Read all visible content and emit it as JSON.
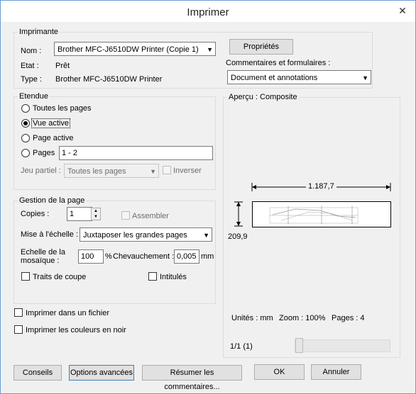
{
  "window": {
    "title": "Imprimer",
    "close_symbol": "✕"
  },
  "printer": {
    "group_label": "Imprimante",
    "name_label": "Nom :",
    "name_value": "Brother MFC-J6510DW Printer (Copie 1)",
    "status_label": "Etat :",
    "status_value": "Prêt",
    "type_label": "Type :",
    "type_value": "Brother MFC-J6510DW Printer",
    "properties_button": "Propriétés",
    "comments_label": "Commentaires et formulaires :",
    "comments_value": "Document et annotations"
  },
  "range": {
    "group_label": "Etendue",
    "options": [
      "Toutes les pages",
      "Vue active",
      "Page active",
      "Pages"
    ],
    "selected": "Vue active",
    "pages_value": "1 - 2",
    "subset_label": "Jeu partiel :",
    "subset_value": "Toutes les pages",
    "reverse_label": "Inverser"
  },
  "page_handling": {
    "group_label": "Gestion de la page",
    "copies_label": "Copies :",
    "copies_value": "1",
    "collate_label": "Assembler",
    "scaling_label": "Mise à l'échelle :",
    "scaling_value": "Juxtaposer les grandes pages",
    "tile_scale_label_1": "Echelle de la",
    "tile_scale_label_2": "mosaïque :",
    "tile_scale_value": "100",
    "percent": "%",
    "overlap_label": "Chevauchement :",
    "overlap_value": "0,005",
    "overlap_unit": "mm",
    "cut_marks_label": "Traits de coupe",
    "labels_label": "Intitulés"
  },
  "output": {
    "print_to_file": "Imprimer dans un fichier",
    "print_bw": "Imprimer les couleurs en noir"
  },
  "preview": {
    "title": "Aperçu : Composite",
    "width_value": "1.187,7",
    "height_value": "209,9",
    "units": "Unités : mm",
    "zoom": "Zoom : 100%",
    "pages": "Pages : 4",
    "page_indicator": "1/1 (1)"
  },
  "buttons": {
    "tips": "Conseils",
    "advanced": "Options avancées",
    "summarize": "Résumer les commentaires...",
    "ok": "OK",
    "cancel": "Annuler"
  }
}
